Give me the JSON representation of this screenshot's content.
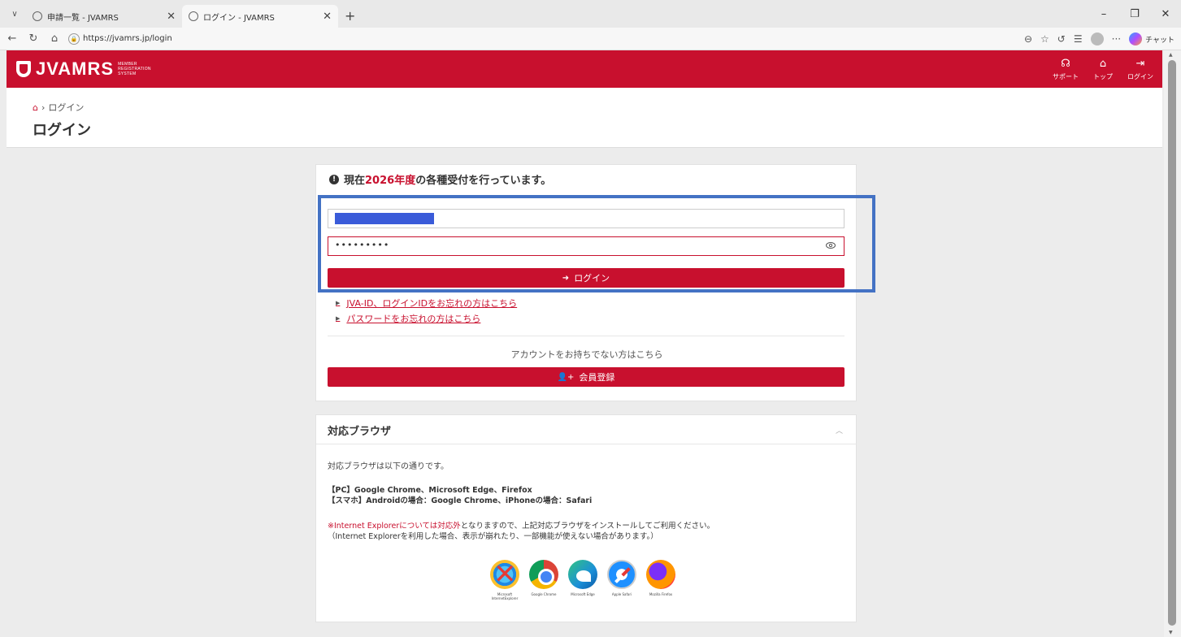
{
  "browser": {
    "tabs": [
      {
        "title": "申請一覧 - JVAMRS",
        "active": false
      },
      {
        "title": "ログイン - JVAMRS",
        "active": true
      }
    ],
    "url": "https://jvamrs.jp/login",
    "chat_label": "チャット"
  },
  "header": {
    "brand": "JVAMRS",
    "brand_sub": [
      "MEMBER",
      "REGISTRATION",
      "SYSTEM"
    ],
    "nav": [
      {
        "label": "サポート",
        "icon": "headset-icon"
      },
      {
        "label": "トップ",
        "icon": "home-icon"
      },
      {
        "label": "ログイン",
        "icon": "login-icon"
      }
    ]
  },
  "breadcrumb": {
    "current": "ログイン"
  },
  "page_title": "ログイン",
  "login": {
    "notice_prefix": "現在",
    "notice_year": "2026年度",
    "notice_suffix": "の各種受付を行っています。",
    "password_mask": "•••••••••",
    "login_button": "ログイン",
    "forgot_id_link": "JVA-ID、ログインIDをお忘れの方はこちら",
    "forgot_pw_link": "パスワードをお忘れの方はこちら",
    "no_account": "アカウントをお持ちでない方はこちら",
    "register_button": "会員登録"
  },
  "support": {
    "title": "対応ブラウザ",
    "intro": "対応ブラウザは以下の通りです。",
    "pc": "【PC】Google Chrome、Microsoft Edge、Firefox",
    "sp": "【スマホ】Androidの場合：Google Chrome、iPhoneの場合：Safari",
    "note_red": "※Internet Explorerについては対応外",
    "note_rest": "となりますので、上記対応ブラウザをインストールしてご利用ください。",
    "note2": "（Internet Explorerを利用した場合、表示が崩れたり、一部機能が使えない場合があります。）",
    "browsers": [
      {
        "caption": "Microsoft InternetExplorer",
        "icon": "ie-icon"
      },
      {
        "caption": "Google Chrome",
        "icon": "chrome-icon"
      },
      {
        "caption": "Microsoft Edge",
        "icon": "edge-icon"
      },
      {
        "caption": "Apple Safari",
        "icon": "safari-icon"
      },
      {
        "caption": "Mozilla Firefox",
        "icon": "firefox-icon"
      }
    ]
  },
  "colors": {
    "brand_red": "#c8102e",
    "highlight_blue": "#4472c4"
  }
}
